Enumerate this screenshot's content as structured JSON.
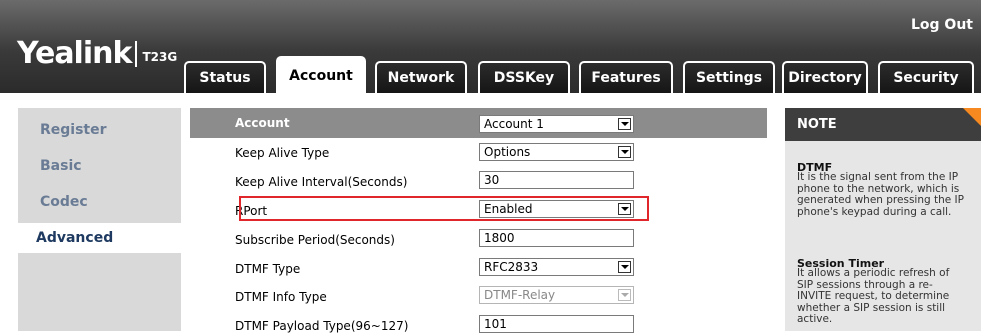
{
  "brand": {
    "name": "Yealink",
    "model": "T23G"
  },
  "header": {
    "logout": "Log Out"
  },
  "tabs": [
    "Status",
    "Account",
    "Network",
    "DSSKey",
    "Features",
    "Settings",
    "Directory",
    "Security"
  ],
  "active_tab": "Account",
  "sidebar": {
    "items": [
      "Register",
      "Basic",
      "Codec",
      "Advanced"
    ],
    "active": "Advanced"
  },
  "form": {
    "header": {
      "label": "Account",
      "value": "Account 1"
    },
    "rows": [
      {
        "label": "Keep Alive Type",
        "value": "Options",
        "type": "select"
      },
      {
        "label": "Keep Alive Interval(Seconds)",
        "value": "30",
        "type": "input"
      },
      {
        "label": "RPort",
        "value": "Enabled",
        "type": "select",
        "highlighted": true
      },
      {
        "label": "Subscribe Period(Seconds)",
        "value": "1800",
        "type": "input"
      },
      {
        "label": "DTMF Type",
        "value": "RFC2833",
        "type": "select"
      },
      {
        "label": "DTMF Info Type",
        "value": "DTMF-Relay",
        "type": "select",
        "disabled": true
      },
      {
        "label": "DTMF Payload Type(96~127)",
        "value": "101",
        "type": "input"
      }
    ]
  },
  "note": {
    "title": "NOTE",
    "sections": [
      {
        "title": "DTMF",
        "lines": [
          "It is the signal sent from the IP",
          "phone to the network, which is",
          "generated when pressing the IP",
          "phone's keypad during a call."
        ]
      },
      {
        "title": "Session Timer",
        "lines": [
          "It allows a periodic refresh of",
          "SIP sessions through a re-",
          "INVITE request, to determine",
          "whether a SIP session is still",
          "active."
        ]
      }
    ]
  },
  "colors": {
    "highlight": "#e0262b",
    "corner": "#f6891f",
    "header_bg": "#3a3a3a"
  }
}
